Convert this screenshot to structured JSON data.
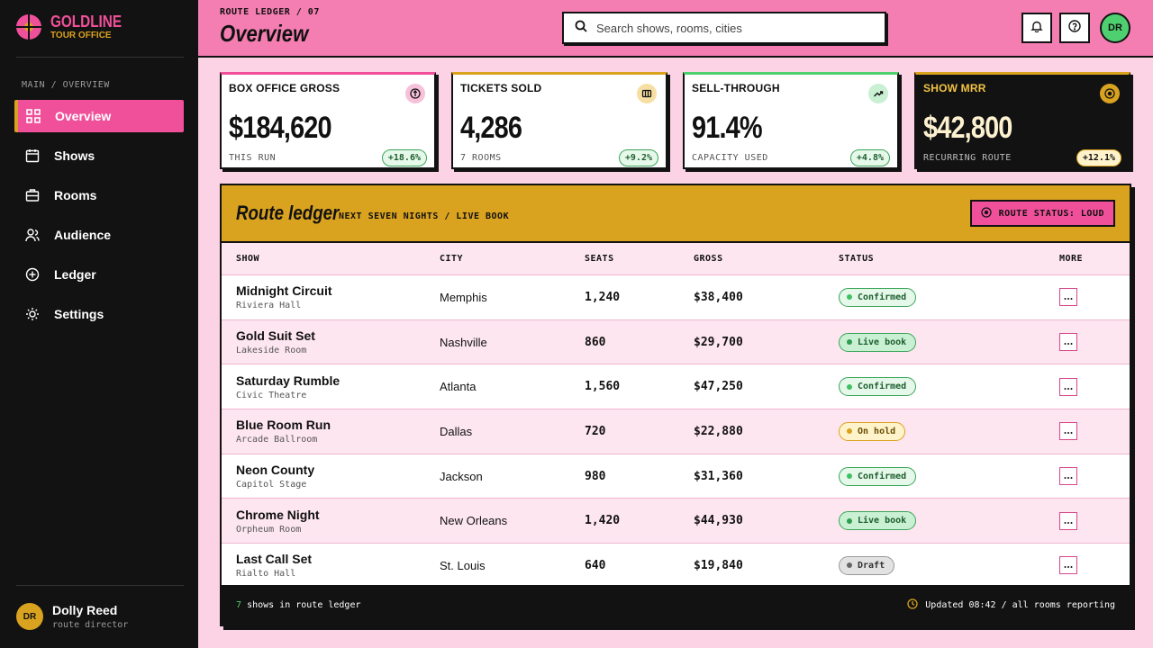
{
  "brand": {
    "name": "GOLDLINE",
    "sub": "TOUR OFFICE"
  },
  "sidebar": {
    "crumb": "MAIN / OVERVIEW",
    "items": [
      {
        "label": "Overview",
        "icon": "grid-icon"
      },
      {
        "label": "Shows",
        "icon": "calendar-icon"
      },
      {
        "label": "Rooms",
        "icon": "briefcase-icon"
      },
      {
        "label": "Audience",
        "icon": "users-icon"
      },
      {
        "label": "Ledger",
        "icon": "plus-circle-icon"
      },
      {
        "label": "Settings",
        "icon": "sun-icon"
      }
    ],
    "user": {
      "initials": "DR",
      "name": "Dolly Reed",
      "role": "route director"
    }
  },
  "header": {
    "kicker": "ROUTE LEDGER / 07",
    "title": "Overview",
    "search_placeholder": "Search shows, rooms, cities",
    "avatar": "DR"
  },
  "stats": [
    {
      "label": "BOX OFFICE GROSS",
      "value": "$184,620",
      "sub": "THIS RUN",
      "delta": "+18.6%",
      "accent": "#f0509a"
    },
    {
      "label": "TICKETS SOLD",
      "value": "4,286",
      "sub": "7 ROOMS",
      "delta": "+9.2%",
      "accent": "#d9a21f"
    },
    {
      "label": "SELL-THROUGH",
      "value": "91.4%",
      "sub": "CAPACITY USED",
      "delta": "+4.8%",
      "accent": "#4fd070"
    },
    {
      "label": "SHOW MRR",
      "value": "$42,800",
      "sub": "RECURRING ROUTE",
      "delta": "+12.1%",
      "accent": "#d9a21f"
    }
  ],
  "ledger": {
    "title": "Route ledger",
    "subtitle": "NEXT SEVEN NIGHTS / LIVE BOOK",
    "status_button": "ROUTE STATUS: LOUD",
    "columns": [
      "SHOW",
      "CITY",
      "SEATS",
      "GROSS",
      "STATUS",
      "MORE"
    ],
    "rows": [
      {
        "show": "Midnight Circuit",
        "room": "Riviera Hall",
        "city": "Memphis",
        "seats": "1,240",
        "gross": "$38,400",
        "status": "Confirmed"
      },
      {
        "show": "Gold Suit Set",
        "room": "Lakeside Room",
        "city": "Nashville",
        "seats": "860",
        "gross": "$29,700",
        "status": "Live book"
      },
      {
        "show": "Saturday Rumble",
        "room": "Civic Theatre",
        "city": "Atlanta",
        "seats": "1,560",
        "gross": "$47,250",
        "status": "Confirmed"
      },
      {
        "show": "Blue Room Run",
        "room": "Arcade Ballroom",
        "city": "Dallas",
        "seats": "720",
        "gross": "$22,880",
        "status": "On hold"
      },
      {
        "show": "Neon County",
        "room": "Capitol Stage",
        "city": "Jackson",
        "seats": "980",
        "gross": "$31,360",
        "status": "Confirmed"
      },
      {
        "show": "Chrome Night",
        "room": "Orpheum Room",
        "city": "New Orleans",
        "seats": "1,420",
        "gross": "$44,930",
        "status": "Live book"
      },
      {
        "show": "Last Call Set",
        "room": "Rialto Hall",
        "city": "St. Louis",
        "seats": "640",
        "gross": "$19,840",
        "status": "Draft"
      }
    ],
    "footer_count": "7",
    "footer_left": "shows in route ledger",
    "footer_right": "Updated 08:42 / all rooms reporting"
  },
  "status_colors": {
    "Confirmed": {
      "bg": "#e6f8ea",
      "border": "#3aa55a",
      "dot": "#3fc25f",
      "text": "#1d5e2e"
    },
    "Live book": {
      "bg": "#c9f0d3",
      "border": "#3aa55a",
      "dot": "#2f9e4f",
      "text": "#1d5e2e"
    },
    "On hold": {
      "bg": "#fff3cc",
      "border": "#d9a21f",
      "dot": "#d9a21f",
      "text": "#6a4e00"
    },
    "Draft": {
      "bg": "#e2e2e2",
      "border": "#999999",
      "dot": "#666666",
      "text": "#333333"
    }
  }
}
